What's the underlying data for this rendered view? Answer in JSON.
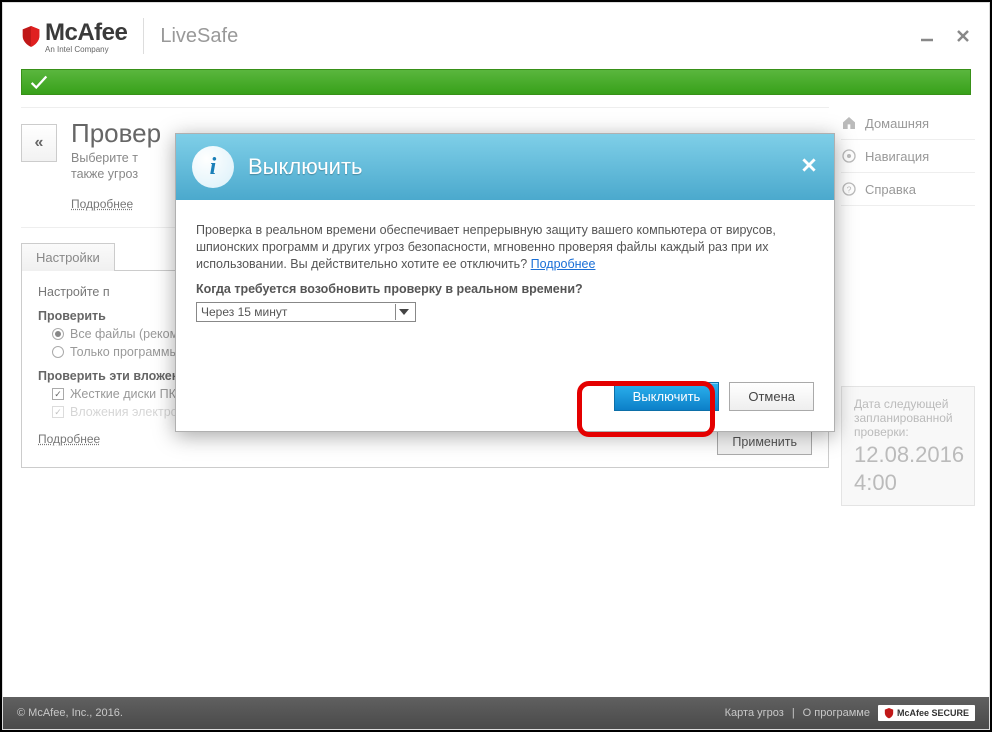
{
  "brand": {
    "name": "McAfee",
    "tagline": "An Intel Company",
    "product": "LiveSafe"
  },
  "sidebar": {
    "items": [
      {
        "label": "Домашняя"
      },
      {
        "label": "Навигация"
      },
      {
        "label": "Справка"
      }
    ]
  },
  "page": {
    "title": "Провер",
    "subtitle1": "Выберите т",
    "subtitle2": "также угроз",
    "more": "Подробнее"
  },
  "settings": {
    "tab": "Настройки",
    "config_hint": "Настройте п",
    "check_heading": "Проверить",
    "radio_all": "Все файлы (рекомендуется)",
    "radio_docs": "Только программы и документы",
    "attach_heading": "Проверить эти вложения и расположения",
    "chk_hdd": "Жесткие диски ПК (автоматически)",
    "chk_email": "Вложения электронной почты",
    "more": "Подробнее",
    "apply": "Применить"
  },
  "next_scan": {
    "label": "Дата следующей запланированной проверки:",
    "date": "12.08.2016",
    "time": "4:00"
  },
  "footer": {
    "copyright": "© McAfee, Inc., 2016.",
    "threat_map": "Карта угроз",
    "about": "О программе",
    "secure": "McAfee SECURE"
  },
  "modal": {
    "title": "Выключить",
    "paragraph": "Проверка в реальном времени обеспечивает непрерывную защиту вашего компьютера от вирусов, шпионских программ и других угроз безопасности, мгновенно проверяя файлы каждый раз при их использовании. Вы действительно хотите ее отключить? ",
    "more": "Подробнее",
    "question": "Когда требуется возобновить проверку в реальном времени?",
    "select_value": "Через 15 минут",
    "primary": "Выключить",
    "secondary": "Отмена"
  }
}
